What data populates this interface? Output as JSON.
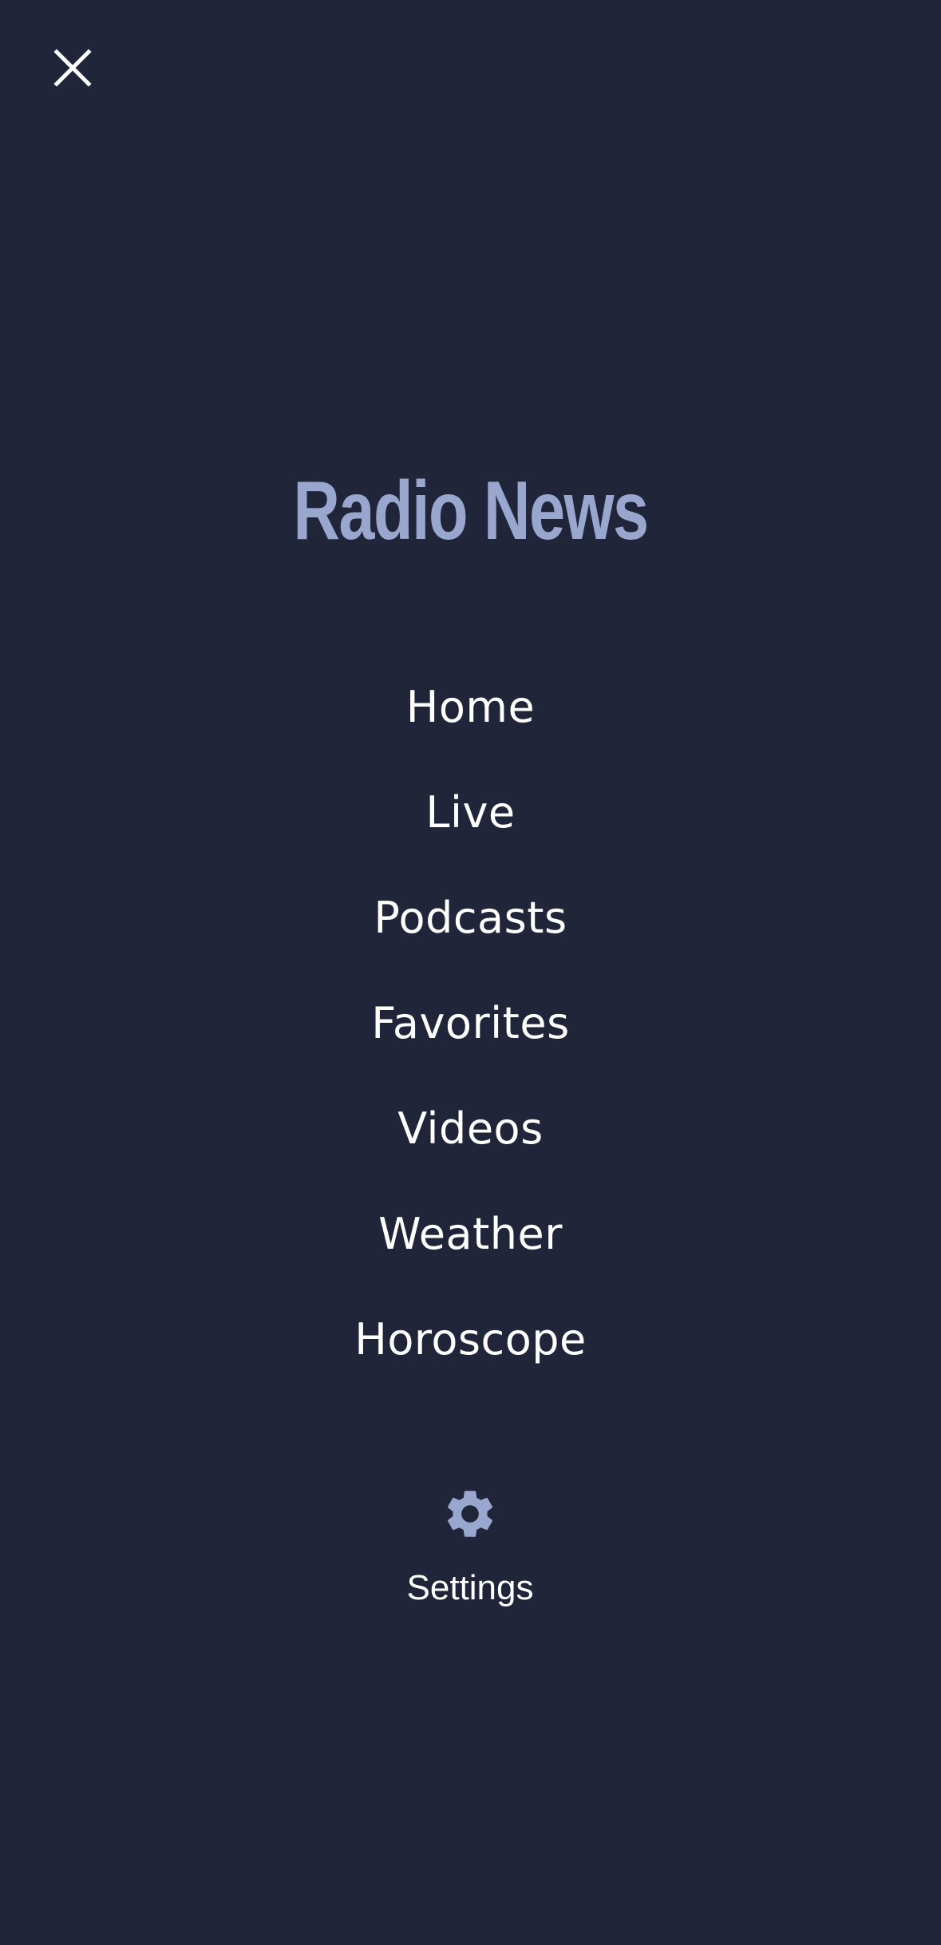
{
  "header": {
    "close_icon": "close-icon"
  },
  "brand": {
    "title": "Radio News"
  },
  "menu": {
    "items": [
      {
        "label": "Home"
      },
      {
        "label": "Live"
      },
      {
        "label": "Podcasts"
      },
      {
        "label": "Favorites"
      },
      {
        "label": "Videos"
      },
      {
        "label": "Weather"
      },
      {
        "label": "Horoscope"
      }
    ]
  },
  "settings": {
    "icon": "gear-icon",
    "label": "Settings"
  },
  "colors": {
    "background": "#202539",
    "accent": "#99a7cf",
    "text": "#ffffff"
  }
}
